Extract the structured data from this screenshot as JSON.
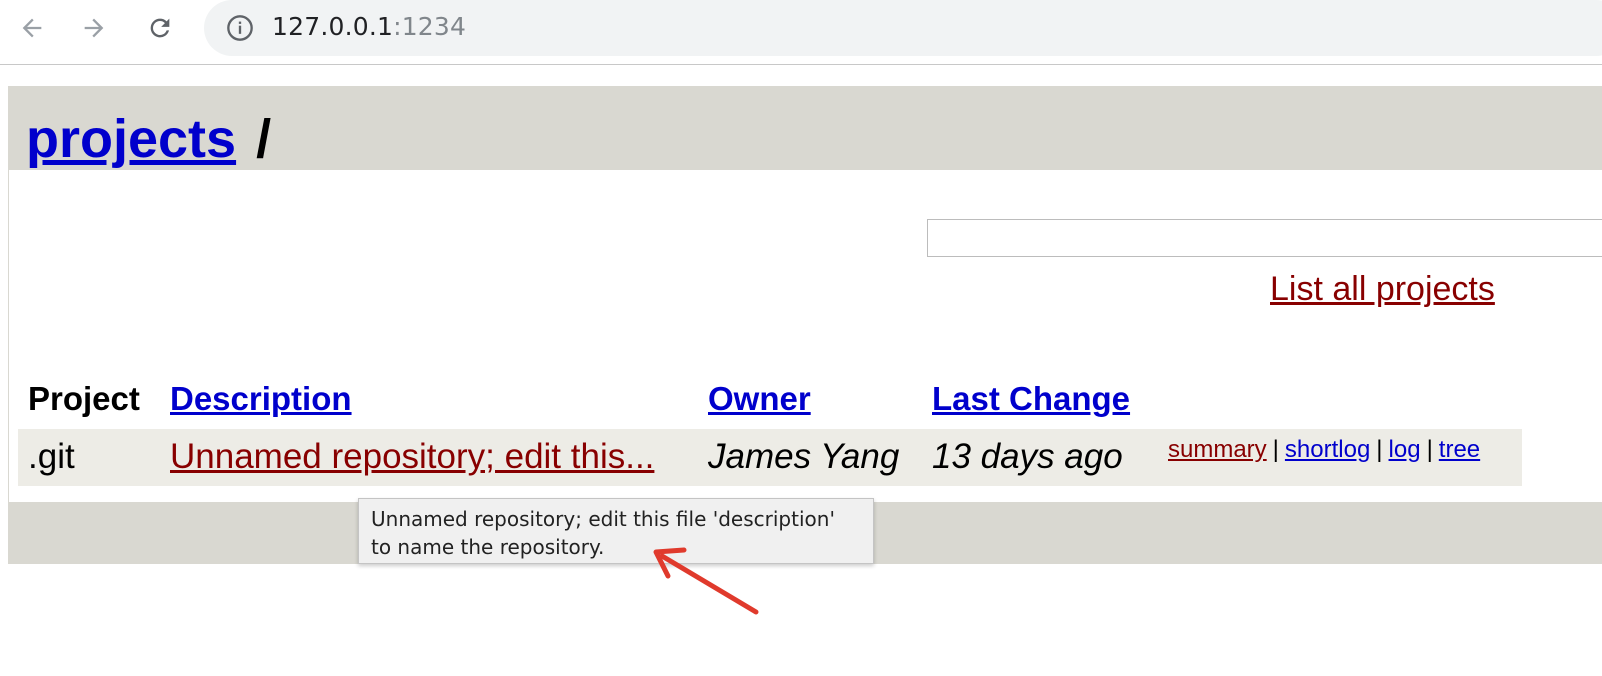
{
  "browser": {
    "url_host": "127.0.0.1",
    "url_port": ":1234"
  },
  "header": {
    "root_link": "projects",
    "separator": "/"
  },
  "search": {
    "placeholder": ""
  },
  "list_all_link": "List all projects",
  "table": {
    "columns": [
      "Project",
      "Description",
      "Owner",
      "Last Change"
    ],
    "rows": [
      {
        "project": ".git",
        "description": "Unnamed repository; edit this...",
        "owner": "James Yang",
        "last_change": "13 days ago",
        "actions": [
          "summary",
          "shortlog",
          "log",
          "tree"
        ]
      }
    ]
  },
  "tooltip": {
    "line1": "Unnamed repository; edit this file 'description'",
    "line2": "to name the repository."
  },
  "colors": {
    "link_blue": "#0000cc",
    "link_red": "#880000",
    "header_bg": "#d9d8d1",
    "row_bg": "#edece6",
    "annotation_arrow": "#e03a2c"
  },
  "icons": [
    "back-arrow-icon",
    "forward-arrow-icon",
    "reload-icon",
    "info-icon"
  ]
}
